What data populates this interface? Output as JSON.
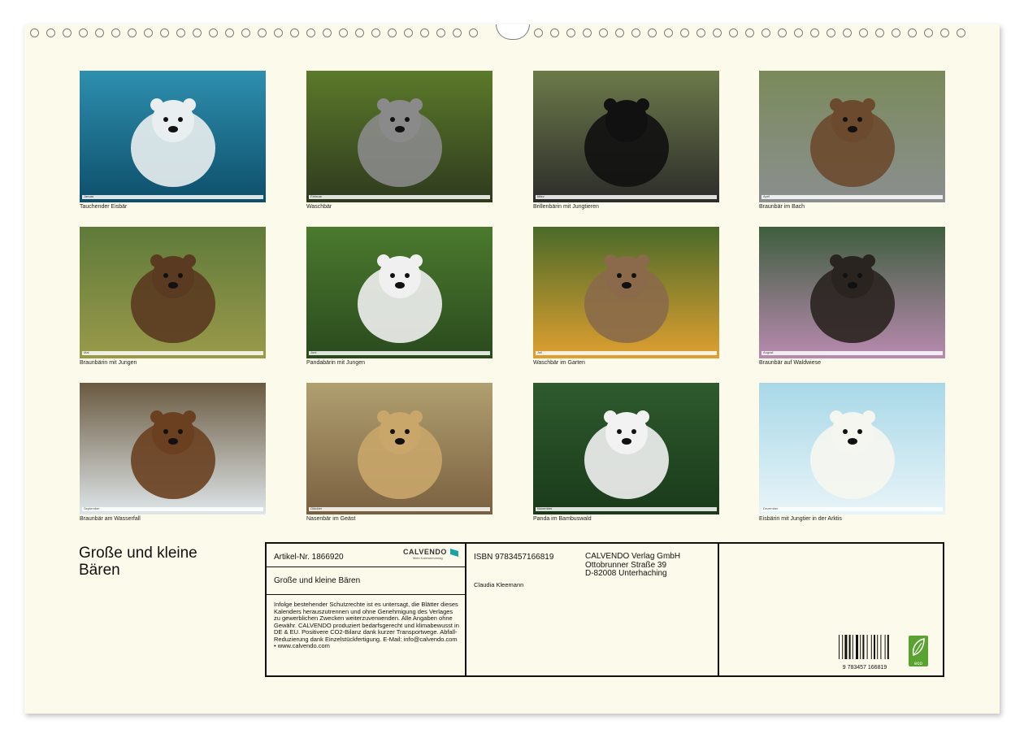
{
  "calendar": {
    "title": "Große und kleine Bären",
    "months": [
      {
        "caption": "Tauchender Eisbär",
        "strip_label": "Januar",
        "scene": "polar-underwater",
        "colors": [
          "#2e8fae",
          "#0d4f6b",
          "#e9eef0"
        ]
      },
      {
        "caption": "Waschbär",
        "strip_label": "Februar",
        "scene": "raccoon-tree",
        "colors": [
          "#5b7a2a",
          "#2f3a1e",
          "#8a8a8a"
        ]
      },
      {
        "caption": "Brillenbärin mit Jungtieren",
        "strip_label": "März",
        "scene": "spectacled-bears",
        "colors": [
          "#6c7a4a",
          "#2c2c2a",
          "#111111"
        ]
      },
      {
        "caption": "Braunbär im Bach",
        "strip_label": "April",
        "scene": "brown-bear-stream",
        "colors": [
          "#7a8a5a",
          "#8b8f90",
          "#6b4a2e"
        ]
      },
      {
        "caption": "Braunbärin mit Jungen",
        "strip_label": "Mai",
        "scene": "brown-bear-meadow",
        "colors": [
          "#5f7a3a",
          "#9a9a4a",
          "#5a3a20"
        ]
      },
      {
        "caption": "Pandabärin mit Jungen",
        "strip_label": "Juni",
        "scene": "panda-bamboo",
        "colors": [
          "#4b7a2e",
          "#2a4a1e",
          "#f0f0f0"
        ]
      },
      {
        "caption": "Waschbär im Garten",
        "strip_label": "Juli",
        "scene": "raccoon-garden",
        "colors": [
          "#4a6a2a",
          "#e0a030",
          "#8a6a4a"
        ]
      },
      {
        "caption": "Braunbär auf Waldwiese",
        "strip_label": "August",
        "scene": "bear-forest-meadow",
        "colors": [
          "#3e5e3e",
          "#b98ab0",
          "#2a2420"
        ]
      },
      {
        "caption": "Braunbär am Wasserfall",
        "strip_label": "September",
        "scene": "bear-waterfall",
        "colors": [
          "#6a5a40",
          "#dfe6ea",
          "#6a4020"
        ]
      },
      {
        "caption": "Nasenbär im Geäst",
        "strip_label": "Oktober",
        "scene": "coati-branch",
        "colors": [
          "#b0a070",
          "#7a6040",
          "#c9a66a"
        ]
      },
      {
        "caption": "Panda im Bambuswald",
        "strip_label": "November",
        "scene": "panda-forest",
        "colors": [
          "#2e5a2e",
          "#1a3a1a",
          "#f2f2f2"
        ]
      },
      {
        "caption": "Eisbärin mit Jungtier in der Arktis",
        "strip_label": "Dezember",
        "scene": "polar-arctic",
        "colors": [
          "#a8d8e8",
          "#e8f4f8",
          "#f6f6f0"
        ]
      }
    ]
  },
  "info": {
    "article": "Artikel-Nr. 1866920",
    "logo_text": "CALVENDO",
    "logo_sub": "Mein Kalenderverlag",
    "product_title": "Große und kleine Bären",
    "legal_text": "Infolge bestehender Schutzrechte ist es untersagt, die Blätter dieses Kalenders herauszutrennen und ohne Genehmigung des Verlages zu gewerblichen Zwecken weiterzuverwenden. Alle Angaben ohne Gewähr. CALVENDO produziert bedarfsgerecht und klimabewusst in DE & EU. Positivere CO2-Bilanz dank kurzer Transportwege. Abfall-Reduzierung dank Einzelstückfertigung. E-Mail: info@calvendo.com • www.calvendo.com",
    "isbn": "ISBN 9783457166819",
    "author": "Claudia Kleemann",
    "publisher_lines": [
      "CALVENDO Verlag GmbH",
      "Ottobrunner Straße 39",
      "D-82008 Unterhaching"
    ],
    "barcode_number": "9 783457 166819",
    "eco_label": "eco",
    "accent_color": "#5aa332",
    "logo_color": "#1aa3a3"
  }
}
